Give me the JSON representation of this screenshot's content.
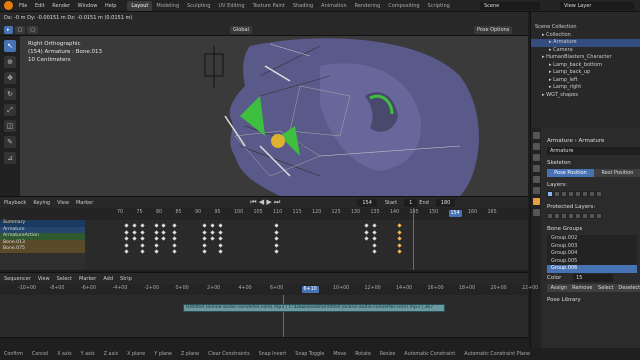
{
  "topbar": {
    "menu": [
      "File",
      "Edit",
      "Render",
      "Window",
      "Help"
    ],
    "workspaces": [
      "Layout",
      "Modeling",
      "Sculpting",
      "UV Editing",
      "Texture Paint",
      "Shading",
      "Animation",
      "Rendering",
      "Compositing",
      "Scripting"
    ],
    "scene": "Scene",
    "view_layer": "View Layer"
  },
  "viewport": {
    "status_line": "Dx: -0 m  Dy: -0.00151 m  Dz: -0.0151 m (0.0151 m)",
    "orientation": "Global",
    "pose_options": "Pose Options",
    "info": [
      "Right Orthographic",
      "(154) Armature : Bone.013",
      "10 Centimeters"
    ]
  },
  "outliner": {
    "rows": [
      {
        "label": "Scene Collection",
        "sel": false,
        "indent": 0
      },
      {
        "label": "Collection",
        "sel": false,
        "indent": 1
      },
      {
        "label": "Armature",
        "sel": true,
        "indent": 2
      },
      {
        "label": "Camera",
        "sel": false,
        "indent": 2
      },
      {
        "label": "HumanBlasters_Character",
        "sel": false,
        "indent": 1
      },
      {
        "label": "Lamp_back_bottom",
        "sel": false,
        "indent": 2
      },
      {
        "label": "Lamp_back_up",
        "sel": false,
        "indent": 2
      },
      {
        "label": "Lamp_left",
        "sel": false,
        "indent": 2
      },
      {
        "label": "Lamp_right",
        "sel": false,
        "indent": 2
      },
      {
        "label": "WGT_shapes",
        "sel": false,
        "indent": 1
      }
    ]
  },
  "properties": {
    "breadcrumb_1": "Armature",
    "breadcrumb_2": "Armature",
    "data_name": "Armature",
    "skeleton_header": "Skeleton",
    "pose_position": "Pose Position",
    "rest_position": "Rest Position",
    "layers_label": "Layers:",
    "protected_layers_label": "Protected Layers:",
    "bone_groups_header": "Bone Groups",
    "groups": [
      {
        "label": "Group.002",
        "sel": false
      },
      {
        "label": "Group.003",
        "sel": false
      },
      {
        "label": "Group.004",
        "sel": false
      },
      {
        "label": "Group.005",
        "sel": false
      },
      {
        "label": "Group.006",
        "sel": true
      }
    ],
    "color_label": "Color",
    "color_value": "15",
    "assign": "Assign",
    "remove": "Remove",
    "select": "Select",
    "deselect": "Deselect",
    "pose_library": "Pose Library"
  },
  "timeline": {
    "menu": [
      "Playback",
      "Keying",
      "View",
      "Marker"
    ],
    "current": "154",
    "start_label": "Start",
    "start": "1",
    "end_label": "End",
    "end": "180",
    "ruler_ticks": [
      "70",
      "75",
      "80",
      "85",
      "90",
      "95",
      "100",
      "105",
      "110",
      "115",
      "120",
      "125",
      "130",
      "135",
      "140",
      "145",
      "150",
      "154",
      "160",
      "165"
    ],
    "channels": [
      {
        "label": "Summary",
        "kind": "summary"
      },
      {
        "label": "Armature",
        "kind": "obj"
      },
      {
        "label": "ArmatureAction",
        "kind": "action"
      },
      {
        "label": "Bone.013",
        "kind": "bone"
      },
      {
        "label": "Bone.075",
        "kind": "bone"
      }
    ]
  },
  "sequencer": {
    "menu": [
      "Sequencer",
      "View",
      "Select",
      "Marker",
      "Add",
      "Strip"
    ],
    "ruler_ticks": [
      "-10+00",
      "-8+00",
      "-6+00",
      "-4+00",
      "-2+00",
      "0+00",
      "2+00",
      "4+00",
      "6+00",
      "6+10",
      "10+00",
      "12+00",
      "14+00",
      "16+00",
      "18+00",
      "20+00",
      "22+00"
    ],
    "playhead": "6+10",
    "strip_label": "Untitled (online-audio-converter.com).mp3 | C:\\Downloads\\Untitled (online-audio-converter.com).mp3 | 367"
  },
  "statusbar": [
    "Confirm",
    "Cancel",
    "X axis",
    "Y axis",
    "Z axis",
    "X plane",
    "Y plane",
    "Z plane",
    "Clear Constraints",
    "Snap Invert",
    "Snap Toggle",
    "Move",
    "Rotate",
    "Resize",
    "Automatic Constraint",
    "Automatic Constraint Plane"
  ]
}
